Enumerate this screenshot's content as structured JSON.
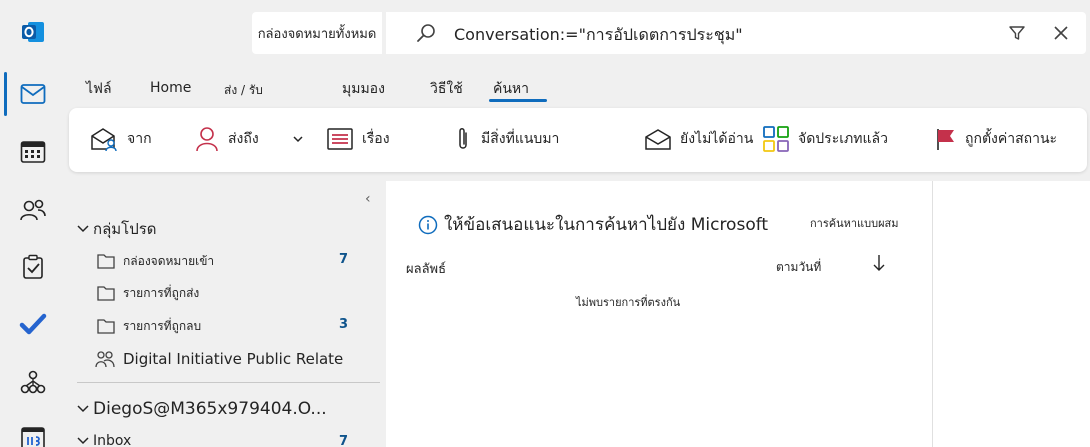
{
  "topbar": {
    "scope_label": "กล่องจดหมายทั้งหมด",
    "search_query": "Conversation:=\"การอัปเดตการประชุม\""
  },
  "tabs": [
    {
      "label": "ไฟล์"
    },
    {
      "label": "Home"
    },
    {
      "label": "ส่ง / รับ"
    },
    {
      "label": "มุมมอง"
    },
    {
      "label": "วิธีใช้"
    },
    {
      "label": "ค้นหา"
    }
  ],
  "ribbon": {
    "from": "จาก",
    "to": "ส่งถึง",
    "subject": "เรื่อง",
    "attachments": "มีสิ่งที่แนบมา",
    "unread": "ยังไม่ได้อ่าน",
    "categorized": "จัดประเภทแล้ว",
    "flagged": "ถูกตั้งค่าสถานะ"
  },
  "folders": {
    "favorites_label": "กลุ่มโปรด",
    "items": [
      {
        "label": "กล่องจดหมายเข้า",
        "count": "7"
      },
      {
        "label": "รายการที่ถูกส่ง",
        "count": ""
      },
      {
        "label": "รายการที่ถูกลบ",
        "count": "3"
      }
    ],
    "group_label": "Digital Initiative Public Relate",
    "account": "DiegoS@M365x979404.O...",
    "inbox_label": "Inbox",
    "inbox_count": "7"
  },
  "message_list": {
    "suggestion": "ให้ข้อเสนอแนะในการค้นหาไปยัง Microsoft",
    "mixed_search": "การค้นหาแบบผสม",
    "results_header": "ผลลัพธ์",
    "sort_by": "ตามวันที่",
    "empty_text": "ไม่พบรายการที่ตรงกัน"
  },
  "colors": {
    "accent": "#0f6cbd",
    "count": "#0f548c",
    "flag": "#c4314b"
  }
}
